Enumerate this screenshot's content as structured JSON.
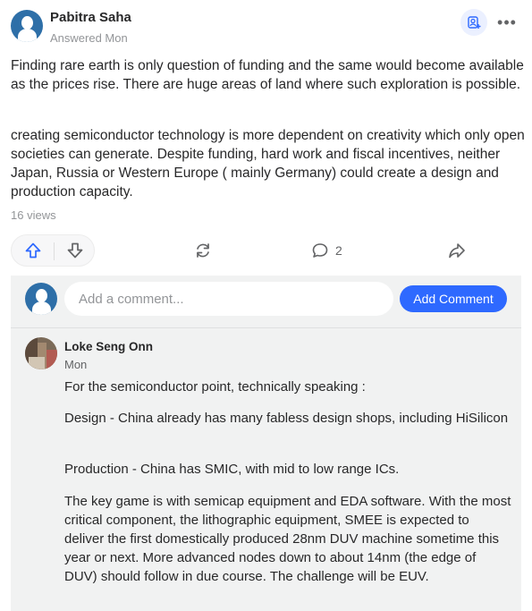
{
  "answer": {
    "author": "Pabitra Saha",
    "meta": "Answered Mon",
    "paragraphs": [
      "Finding rare earth is only question of funding and the same would become available as the prices rise. There are huge areas of land where such exploration is possible.",
      "creating semiconductor technology is more dependent on creativity which only open societies can generate. Despite funding, hard work and fiscal incentives, neither Japan, Russia or Western Europe ( mainly Germany) could create a design and production capacity."
    ],
    "views": "16 views"
  },
  "actions": {
    "more_label": "•••",
    "comment_count": "2"
  },
  "comment_box": {
    "placeholder": "Add a comment...",
    "value": "",
    "button_label": "Add Comment"
  },
  "comments": [
    {
      "author": "Loke Seng Onn",
      "date": "Mon",
      "paragraphs": [
        "For the semiconductor point, technically speaking :",
        "Design - China already has many fabless design shops, including HiSilicon",
        "Production - China has SMIC, with mid to low range ICs.",
        "The key game is with semicap equipment and EDA software. With the most critical component, the lithographic equipment, SMEE is expected to deliver the first domestically produced 28nm DUV machine sometime this year or next. More advanced nodes down to about 14nm (the edge of DUV) should follow in due course. The challenge will be EUV."
      ]
    }
  ],
  "icons": {
    "follow": "add-person-icon",
    "more": "more-dots-icon",
    "upvote": "upvote-arrow-icon",
    "downvote": "downvote-arrow-icon",
    "share": "share-cycle-icon",
    "comment": "comment-bubble-icon",
    "forward": "forward-arrow-icon"
  },
  "colors": {
    "accent": "#2e69ff",
    "avatar_blue": "#2e6fa8",
    "upvote_blue": "#2e69ff",
    "muted_text": "#939598",
    "comment_bg": "#f1f2f2"
  }
}
